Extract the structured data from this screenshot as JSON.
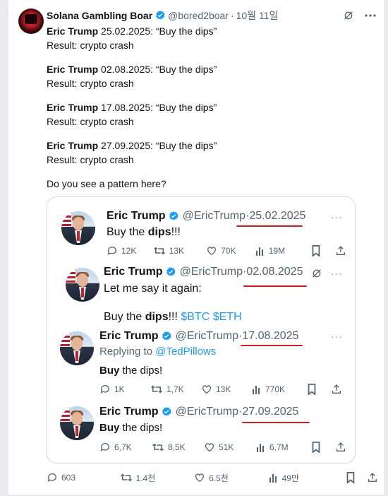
{
  "post": {
    "author_name": "Solana Gambling Boar",
    "handle": "@bored2boar",
    "separator": "·",
    "date": "10월 11일",
    "lines": [
      {
        "bold": "Eric Trump",
        "rest": " 25.02.2025: “Buy the dips”",
        "result": "Result: crypto crash"
      },
      {
        "bold": "Eric Trump",
        "rest": " 02.08.2025: “Buy the dips”",
        "result": "Result: crypto crash"
      },
      {
        "bold": "Eric Trump",
        "rest": " 17.08.2025: “Buy the dips”",
        "result": "Result: crypto crash"
      },
      {
        "bold": "Eric Trump",
        "rest": " 27.09.2025: “Buy the dips”",
        "result": "Result: crypto crash"
      }
    ],
    "closing": "Do you see a pattern here?"
  },
  "quote": {
    "shots": [
      {
        "name": "Eric Trump",
        "handle": "@EricTrump",
        "sep": "·",
        "date": "25.02.2025",
        "body_pre": "Buy the ",
        "body_bold": "dips",
        "body_post": "!!!",
        "stats": {
          "replies": "12K",
          "reposts": "13K",
          "likes": "70K",
          "views": "19M"
        }
      },
      {
        "name": "Eric Trump",
        "handle": "@EricTrump",
        "sep": "·",
        "date": "02.08.2025",
        "body_line1": "Let me say it again:",
        "body2_pre": "Buy the ",
        "body2_bold": "dips",
        "body2_post": "!!! ",
        "tag1": "$BTC",
        "tag2": "$ETH"
      },
      {
        "name": "Eric Trump",
        "handle": "@EricTrump",
        "sep": "·",
        "date": "17.08.2025",
        "reply_prefix": "Replying to ",
        "reply_to": "@TedPillows",
        "body_bold": "Buy",
        "body_post": " the dips!",
        "stats": {
          "replies": "1K",
          "reposts": "1,7K",
          "likes": "13K",
          "views": "770K"
        }
      },
      {
        "name": "Eric Trump",
        "handle": "@EricTrump",
        "sep": "·",
        "date": "27.09.2025",
        "body_bold": "Buy",
        "body_post": " the dips!",
        "stats": {
          "replies": "6,7K",
          "reposts": "8,5K",
          "likes": "51K",
          "views": "6,7M"
        }
      }
    ]
  },
  "footer": {
    "replies": "603",
    "reposts": "1.4천",
    "likes": "6.5천",
    "views": "49만"
  },
  "colors": {
    "verified": "#1d9bf0",
    "underline": "#d11f26",
    "link": "#1d9bf0",
    "muted": "#536471"
  }
}
